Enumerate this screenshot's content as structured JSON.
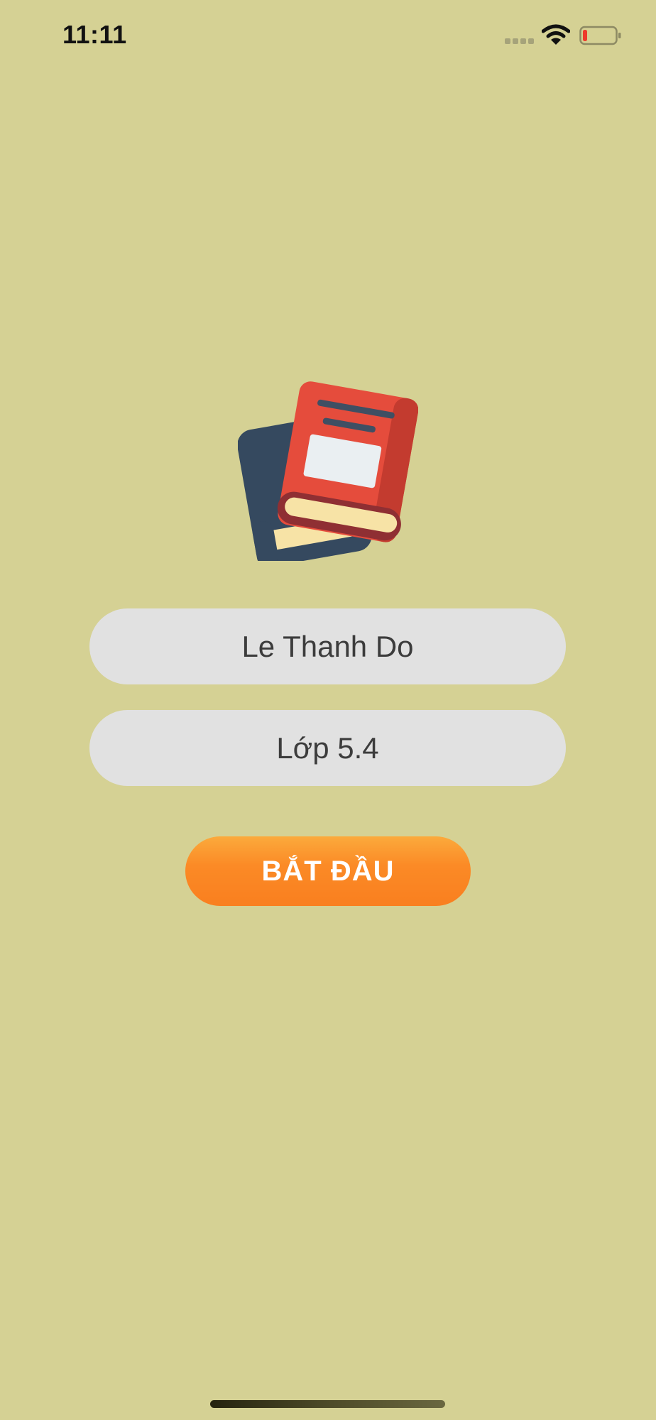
{
  "status_bar": {
    "time": "11:11"
  },
  "icons": {
    "signal": "cellular-signal-icon",
    "wifi": "wifi-icon",
    "battery": "battery-low-icon",
    "logo": "books-logo-icon"
  },
  "form": {
    "name_value": "Le Thanh Do",
    "class_value": "Lớp 5.4"
  },
  "actions": {
    "start_label": "BẮT ĐẦU"
  },
  "colors": {
    "background": "#d5d194",
    "field_background": "#e1e1e1",
    "button_accent": "#fb8a26",
    "battery_level": "#ee3a2c"
  }
}
